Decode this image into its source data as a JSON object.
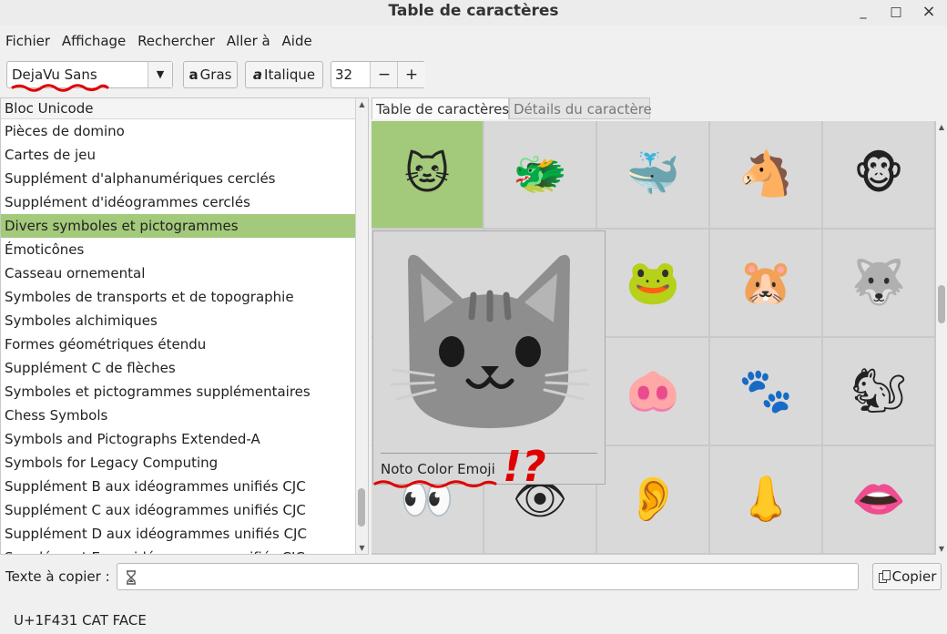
{
  "window": {
    "title": "Table de caractères",
    "minimize": "_",
    "maximize": "□",
    "close": "×"
  },
  "menu": [
    {
      "label": "Fichier"
    },
    {
      "label": "Affichage"
    },
    {
      "label": "Rechercher"
    },
    {
      "label": "Aller à"
    },
    {
      "label": "Aide"
    }
  ],
  "toolbar": {
    "font": "DejaVu Sans",
    "bold_icon": "a",
    "bold_label": "Gras",
    "italic_icon": "a",
    "italic_label": "Italique",
    "size": "32",
    "minus": "−",
    "plus": "+"
  },
  "blocks": {
    "header": "Bloc Unicode",
    "items": [
      {
        "label": "Pièces de domino"
      },
      {
        "label": "Cartes de jeu"
      },
      {
        "label": "Supplément d'alphanumériques cerclés"
      },
      {
        "label": "Supplément d'idéogrammes cerclés"
      },
      {
        "label": "Divers symboles et pictogrammes",
        "selected": true
      },
      {
        "label": "Émoticônes"
      },
      {
        "label": "Casseau ornemental"
      },
      {
        "label": "Symboles de transports et de topographie"
      },
      {
        "label": "Symboles alchimiques"
      },
      {
        "label": "Formes géométriques étendu"
      },
      {
        "label": "Supplément C de flèches"
      },
      {
        "label": "Symboles et pictogrammes supplémentaires"
      },
      {
        "label": "Chess Symbols"
      },
      {
        "label": "Symbols and Pictographs Extended-A"
      },
      {
        "label": "Symbols for Legacy Computing"
      },
      {
        "label": "Supplément B aux idéogrammes unifiés CJC"
      },
      {
        "label": "Supplément C aux idéogrammes unifiés CJC"
      },
      {
        "label": "Supplément D aux idéogrammes unifiés CJC"
      },
      {
        "label": "Supplément E aux idéogrammes unifiés CJC"
      }
    ]
  },
  "tabs": [
    {
      "label": "Table de caractères",
      "active": true
    },
    {
      "label": "Détails du caractère",
      "active": false
    }
  ],
  "grid": {
    "cells": [
      {
        "glyph": "🐱",
        "icon": "cat-face-icon",
        "selected": true
      },
      {
        "glyph": "🐲",
        "icon": "dragon-face-icon"
      },
      {
        "glyph": "🐳",
        "icon": "spouting-whale-icon"
      },
      {
        "glyph": "🐴",
        "icon": "horse-face-icon"
      },
      {
        "glyph": "🐵",
        "icon": "monkey-face-icon"
      },
      {
        "glyph": "",
        "icon": "hidden-cell"
      },
      {
        "glyph": "",
        "icon": "hidden-cell"
      },
      {
        "glyph": "🐸",
        "icon": "frog-face-icon"
      },
      {
        "glyph": "🐹",
        "icon": "hamster-face-icon"
      },
      {
        "glyph": "🐺",
        "icon": "wolf-face-icon"
      },
      {
        "glyph": "",
        "icon": "hidden-cell"
      },
      {
        "glyph": "",
        "icon": "hidden-cell"
      },
      {
        "glyph": "🐽",
        "icon": "pig-nose-icon"
      },
      {
        "glyph": "🐾",
        "icon": "paw-prints-icon"
      },
      {
        "glyph": "🐿",
        "icon": "chipmunk-icon"
      },
      {
        "glyph": "👀",
        "icon": "eyes-icon"
      },
      {
        "glyph": "👁",
        "icon": "eye-icon"
      },
      {
        "glyph": "👂",
        "icon": "ear-icon"
      },
      {
        "glyph": "👃",
        "icon": "nose-icon"
      },
      {
        "glyph": "👄",
        "icon": "mouth-icon"
      }
    ]
  },
  "popup": {
    "font_name": "Noto Color Emoji"
  },
  "annotation": {
    "text": "!?"
  },
  "bottom": {
    "copy_label": "Texte à copier :",
    "copy_button": "Copier"
  },
  "status": {
    "text": "U+1F431 CAT FACE"
  },
  "colors": {
    "selection": "#a3c97a",
    "annotation": "#e00000",
    "cell": "#d9d9d9"
  }
}
